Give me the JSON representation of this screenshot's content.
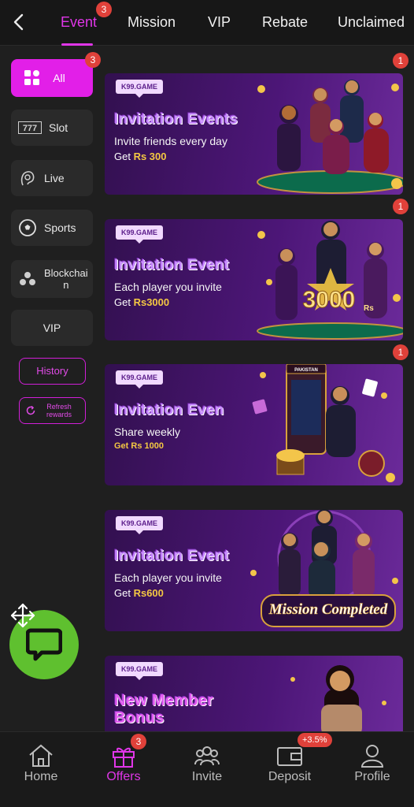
{
  "tabs": [
    {
      "label": "Event",
      "active": true,
      "badge": "3"
    },
    {
      "label": "Mission"
    },
    {
      "label": "VIP"
    },
    {
      "label": "Rebate"
    },
    {
      "label": "Unclaimed"
    }
  ],
  "sidebar": {
    "all": {
      "label": "All",
      "badge": "3"
    },
    "items": [
      {
        "label": "Slot",
        "icon": "slot-777-icon"
      },
      {
        "label": "Live",
        "icon": "live-dealer-icon"
      },
      {
        "label": "Sports",
        "icon": "soccer-ball-icon"
      },
      {
        "label": "Blockchai\nn",
        "icon": "blockchain-icon"
      },
      {
        "label": "VIP"
      }
    ],
    "history_label": "History",
    "refresh_label": "Refresh rewards"
  },
  "banners": [
    {
      "brand": "K99.GAME",
      "title": "Invitation Events",
      "subtitle": "Invite friends every day",
      "amount_prefix": "Get ",
      "amount": "Rs 300",
      "badge": "1"
    },
    {
      "brand": "K99.GAME",
      "title": "Invitation Event",
      "subtitle": "Each player you invite",
      "amount_prefix": "Get ",
      "amount": "Rs3000",
      "art_text": "3000",
      "art_unit": "Rs",
      "badge": "1"
    },
    {
      "brand": "K99.GAME",
      "title": "Invitation Even",
      "subtitle": "Share weekly",
      "amount_prefix": "",
      "amount": "Get Rs 1000",
      "art_text": "PAKISTAN",
      "badge": "1"
    },
    {
      "brand": "K99.GAME",
      "title": "Invitation Event",
      "subtitle": "Each player you invite",
      "amount_prefix": "Get ",
      "amount": "Rs600",
      "art_text": "Mission Completed"
    },
    {
      "brand": "K99.GAME",
      "title": "New Member",
      "title2": "Bonus"
    }
  ],
  "bottom_nav": [
    {
      "label": "Home",
      "icon": "home-icon"
    },
    {
      "label": "Offers",
      "icon": "gift-icon",
      "active": true,
      "badge": "3"
    },
    {
      "label": "Invite",
      "icon": "people-icon"
    },
    {
      "label": "Deposit",
      "icon": "wallet-icon",
      "badge": "+3.5%"
    },
    {
      "label": "Profile",
      "icon": "profile-icon"
    }
  ],
  "colors": {
    "accent": "#e036e8",
    "badge": "#e0413a",
    "chat": "#5fc02f"
  }
}
